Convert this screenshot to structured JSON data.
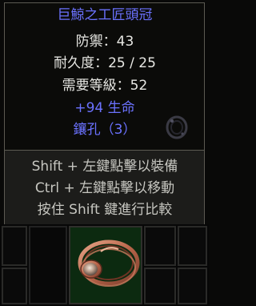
{
  "tooltip": {
    "item_name": "巨鯨之工匠頭冠",
    "defense": "防禦：43",
    "durability": "耐久度：25 / 25",
    "required_level": "需要等級：52",
    "magic_property": "+94 生命",
    "sockets": "鑲孔（3）",
    "hints": [
      "Shift + 左鍵點擊以裝備",
      "Ctrl + 左鍵點擊以移動",
      "按住 Shift 鍵進行比較"
    ]
  },
  "colors": {
    "magic_blue": "#6b72ff",
    "stat_white": "#e8e8e4",
    "hint_gray": "#c6c6c0",
    "inventory_item_bg": "#0c2a10"
  },
  "icons": {
    "item": "circlet-icon",
    "socketed_gem": "gem-ring-icon"
  }
}
